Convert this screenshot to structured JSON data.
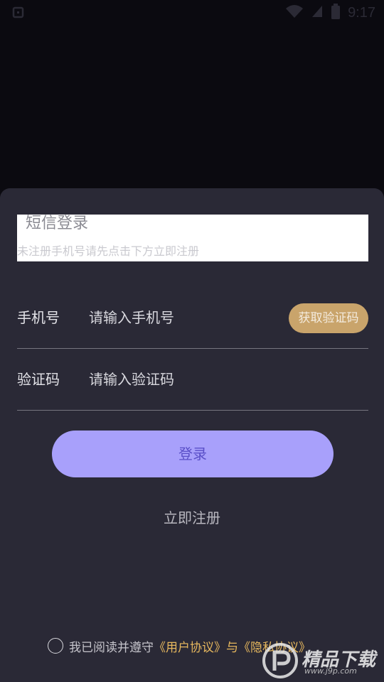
{
  "status_bar": {
    "time": "9:17",
    "icons": [
      "notification-icon",
      "wifi-icon",
      "signal-icon",
      "battery-icon"
    ]
  },
  "login": {
    "title": "短信登录",
    "subtitle": "未注册手机号请先点击下方立即注册",
    "phone": {
      "label": "手机号",
      "placeholder": "请输入手机号",
      "value": "",
      "get_code_label": "获取验证码"
    },
    "code": {
      "label": "验证码",
      "placeholder": "请输入验证码",
      "value": ""
    },
    "login_button": "登录",
    "register_link": "立即注册"
  },
  "agreement": {
    "checked": false,
    "prefix": "我已阅读并遵守",
    "user_agreement": "《用户协议》",
    "and": "与",
    "privacy_policy": "《隐私协议》"
  },
  "watermark": {
    "text": "精品下载",
    "sub": "www.j9p.com"
  },
  "colors": {
    "accent_gold": "#c9a46b",
    "button_purple": "#a8a0fb",
    "link_gold": "#e7b85e",
    "sheet_bg": "#2a2936"
  }
}
